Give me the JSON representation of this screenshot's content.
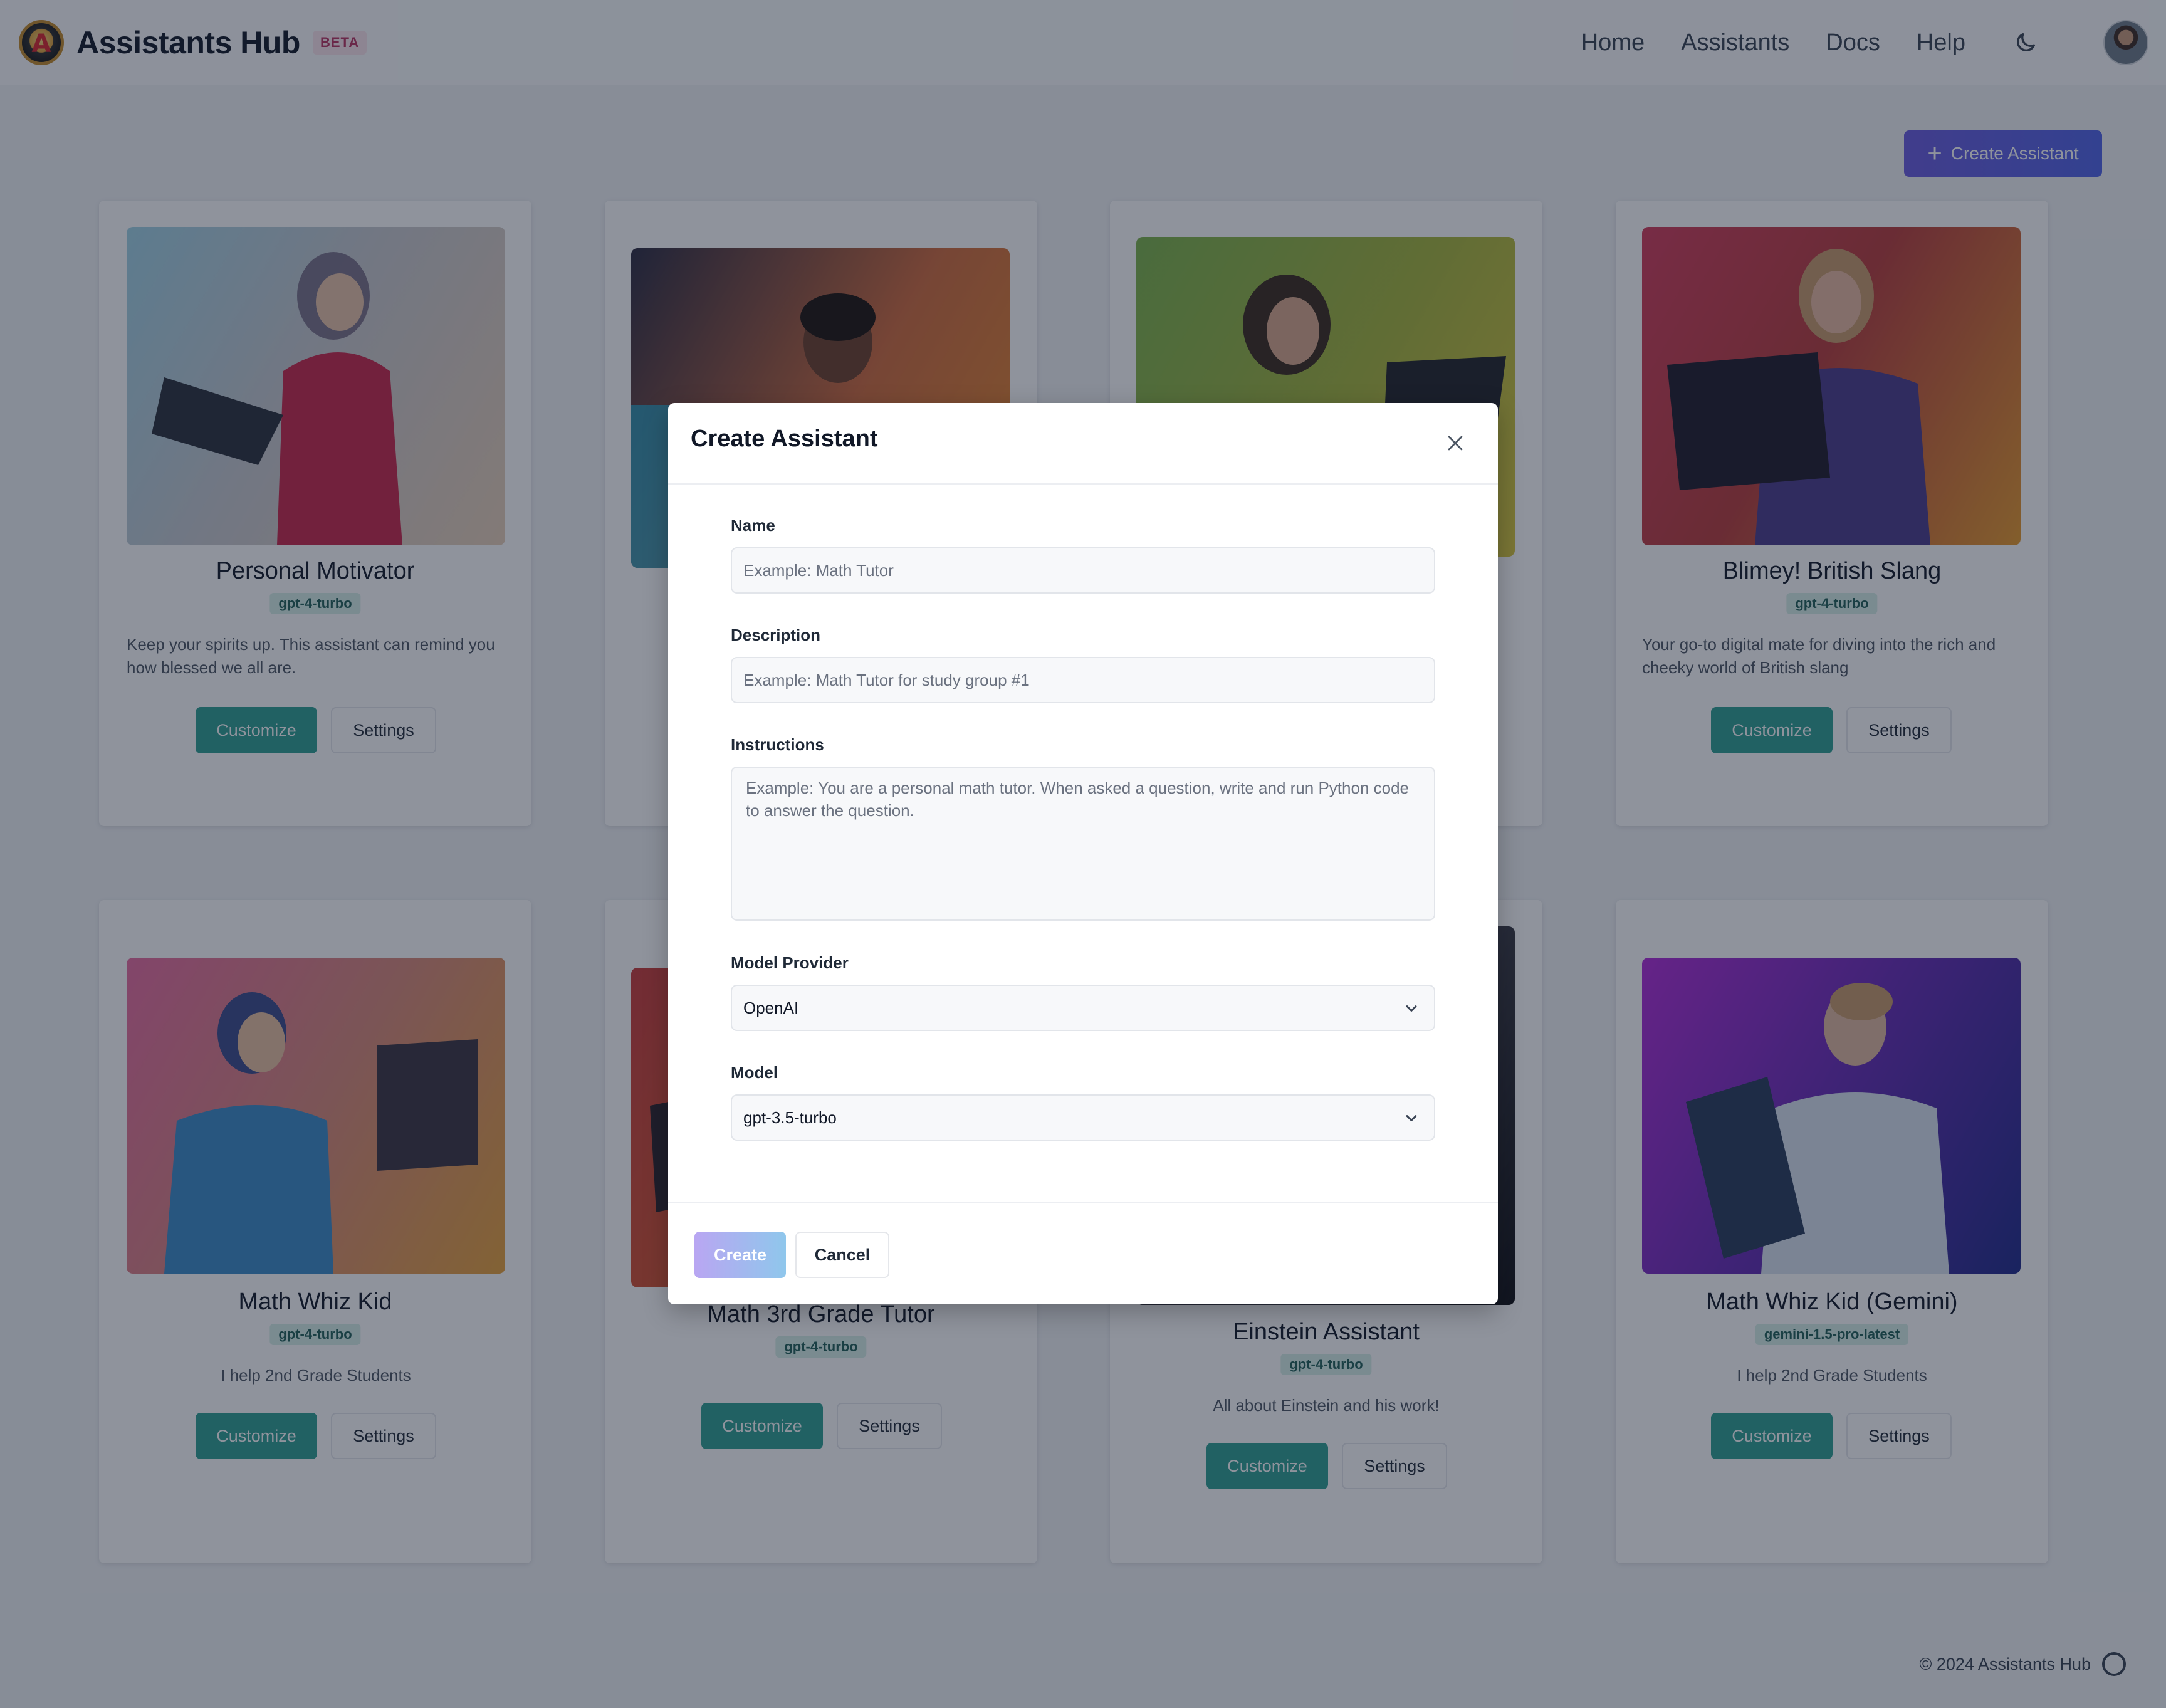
{
  "header": {
    "brand": "Assistants Hub",
    "badge": "BETA",
    "nav": [
      "Home",
      "Assistants",
      "Docs",
      "Help"
    ],
    "theme_icon": "moon-icon",
    "avatar_icon": "user-avatar"
  },
  "create_button_label": "Create Assistant",
  "cards": [
    {
      "title": "Personal Motivator",
      "model": "gpt-4-turbo",
      "description": "Keep your spirits up. This assistant can remind you how blessed we all are.",
      "customize": "Customize",
      "settings": "Settings"
    },
    {
      "title": "",
      "model": "",
      "description": "",
      "customize": "",
      "settings": ""
    },
    {
      "title": "",
      "model": "",
      "description": "",
      "customize": "",
      "settings": ""
    },
    {
      "title": "Blimey! British Slang",
      "model": "gpt-4-turbo",
      "description": "Your go-to digital mate for diving into the rich and cheeky world of British slang",
      "customize": "Customize",
      "settings": "Settings"
    },
    {
      "title": "Math Whiz Kid",
      "model": "gpt-4-turbo",
      "description": "I help 2nd Grade Students",
      "customize": "Customize",
      "settings": "Settings"
    },
    {
      "title": "Math 3rd Grade Tutor",
      "model": "gpt-4-turbo",
      "description": "",
      "customize": "Customize",
      "settings": "Settings"
    },
    {
      "title": "Einstein Assistant",
      "model": "gpt-4-turbo",
      "description": "All about Einstein and his work!",
      "customize": "Customize",
      "settings": "Settings"
    },
    {
      "title": "Math Whiz Kid (Gemini)",
      "model": "gemini-1.5-pro-latest",
      "description": "I help 2nd Grade Students",
      "customize": "Customize",
      "settings": "Settings"
    }
  ],
  "modal": {
    "title": "Create Assistant",
    "name_label": "Name",
    "name_placeholder": "Example: Math Tutor",
    "description_label": "Description",
    "description_placeholder": "Example: Math Tutor for study group #1",
    "instructions_label": "Instructions",
    "instructions_placeholder": "Example: You are a personal math tutor. When asked a question, write and run Python code to answer the question.",
    "provider_label": "Model Provider",
    "provider_value": "OpenAI",
    "model_label": "Model",
    "model_value": "gpt-3.5-turbo",
    "create_label": "Create",
    "cancel_label": "Cancel"
  },
  "footer": {
    "text": "© 2024 Assistants Hub",
    "icon": "github-icon"
  },
  "colors": {
    "accent": "#2c9f93",
    "primary": "#5b5fe6",
    "badge": "#b83261"
  }
}
